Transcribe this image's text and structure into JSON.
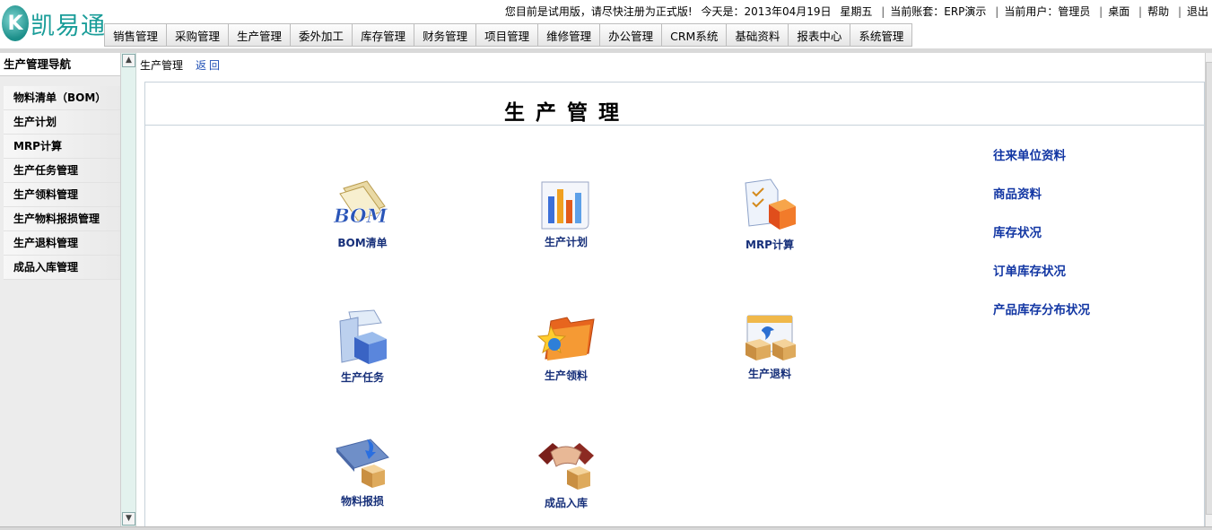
{
  "logo": {
    "mark": "K",
    "text": "凯易通"
  },
  "topinfo": {
    "trial_notice": "您目前是试用版，请尽快注册为正式版!",
    "date_label": "今天是：2013年04月19日",
    "weekday": "星期五",
    "account": "当前账套：ERP演示",
    "user": "当前用户：管理员",
    "desktop": "桌面",
    "help": "帮助",
    "logout": "退出"
  },
  "menu": [
    "销售管理",
    "采购管理",
    "生产管理",
    "委外加工",
    "库存管理",
    "财务管理",
    "项目管理",
    "维修管理",
    "办公管理",
    "CRM系统",
    "基础资料",
    "报表中心",
    "系统管理"
  ],
  "leftnav": {
    "title": "生产管理导航",
    "items": [
      "物料清单（BOM）",
      "生产计划",
      "MRP计算",
      "生产任务管理",
      "生产领料管理",
      "生产物料报损管理",
      "生产退料管理",
      "成品入库管理"
    ]
  },
  "breadcrumb": {
    "current": "生产管理",
    "back": "返回"
  },
  "panel_title": "生产管理",
  "tiles": [
    {
      "label": "BOM清单",
      "icon": "bom-icon",
      "art_text": "BOM"
    },
    {
      "label": "生产计划",
      "icon": "bar-chart-icon"
    },
    {
      "label": "MRP计算",
      "icon": "document-box-icon"
    },
    {
      "label": "生产任务",
      "icon": "task-box-icon"
    },
    {
      "label": "生产领料",
      "icon": "star-folder-icon"
    },
    {
      "label": "生产退料",
      "icon": "return-box-icon"
    },
    {
      "label": "物料报损",
      "icon": "damage-box-icon"
    },
    {
      "label": "成品入库",
      "icon": "handshake-box-icon"
    }
  ],
  "quick_links": [
    "往来单位资料",
    "商品资料",
    "库存状况",
    "订单库存状况",
    "产品库存分布状况"
  ],
  "colors": {
    "brand": "#1a9d99",
    "link": "#1236a3",
    "tile_label": "#17307a"
  }
}
